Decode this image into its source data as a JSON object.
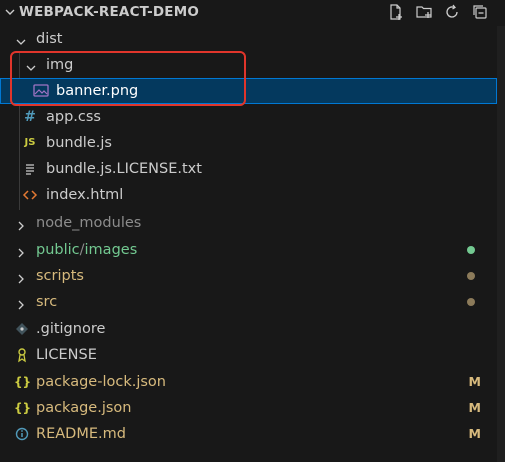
{
  "header": {
    "title": "WEBPACK-REACT-DEMO",
    "actions": [
      "new-file-icon",
      "new-folder-icon",
      "refresh-icon",
      "collapse-all-icon"
    ]
  },
  "colors": {
    "background": "#181818",
    "selection": "#04395e",
    "selection_border": "#0078d4",
    "annotation_box": "#e0352b",
    "modified": "#d7ba7d",
    "untracked": "#73c991",
    "folder_dot": "#8c7b5a"
  },
  "tree": [
    {
      "label": "dist",
      "type": "folder",
      "expanded": true
    },
    {
      "label": "img",
      "type": "folder",
      "expanded": true
    },
    {
      "label": "banner.png",
      "type": "image-file",
      "selected": true
    },
    {
      "label": "app.css",
      "type": "css-file"
    },
    {
      "label": "bundle.js",
      "type": "js-file"
    },
    {
      "label": "bundle.js.LICENSE.txt",
      "type": "text-file"
    },
    {
      "label": "index.html",
      "type": "html-file"
    },
    {
      "label": "node_modules",
      "type": "folder",
      "expanded": false
    },
    {
      "label": "public",
      "label_sep": "/",
      "label_rest": "images",
      "type": "folder",
      "expanded": false,
      "status_color": "#73c991"
    },
    {
      "label": "scripts",
      "type": "folder",
      "expanded": false,
      "status_color": "#8c7b5a"
    },
    {
      "label": "src",
      "type": "folder",
      "expanded": false,
      "status_color": "#8c7b5a"
    },
    {
      "label": ".gitignore",
      "type": "git-file"
    },
    {
      "label": "LICENSE",
      "type": "license-file"
    },
    {
      "label": "package-lock.json",
      "type": "json-file",
      "badge": "M"
    },
    {
      "label": "package.json",
      "type": "json-file",
      "badge": "M"
    },
    {
      "label": "README.md",
      "type": "info-file",
      "badge": "M"
    }
  ]
}
